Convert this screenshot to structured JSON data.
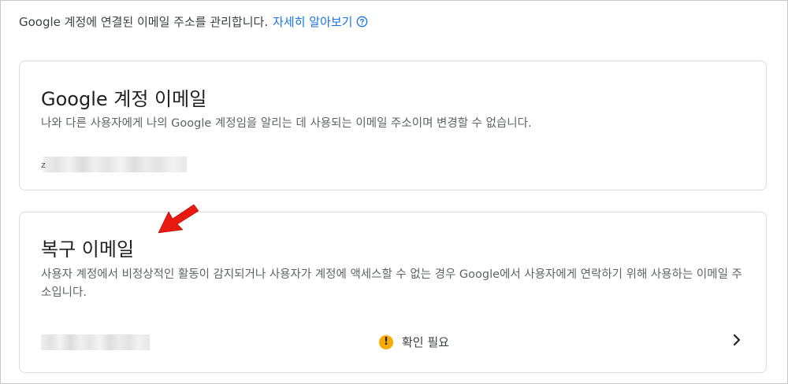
{
  "intro": {
    "text": "Google 계정에 연결된 이메일 주소를 관리합니다.",
    "link": "자세히 알아보기"
  },
  "google_account_email": {
    "title": "Google 계정 이메일",
    "description": "나와 다른 사용자에게 나의 Google 계정임을 알리는 데 사용되는 이메일 주소이며 변경할 수 없습니다.",
    "email_fragment": "z"
  },
  "recovery_email": {
    "title": "복구 이메일",
    "description": "사용자 계정에서 비정상적인 활동이 감지되거나 사용자가 계정에 액세스할 수 없는 경우 Google에서 사용자에게 연락하기 위해 사용하는 이메일 주소입니다.",
    "status": "확인 필요"
  },
  "colors": {
    "link": "#1a73e8",
    "warning": "#f9ab00",
    "annotation_arrow": "#e8190e",
    "card_border": "#dadce0"
  },
  "icons": {
    "help": "help-circle-icon",
    "warning": "warning-icon",
    "chevron": "chevron-right-icon",
    "annotation": "red-arrow-annotation"
  }
}
